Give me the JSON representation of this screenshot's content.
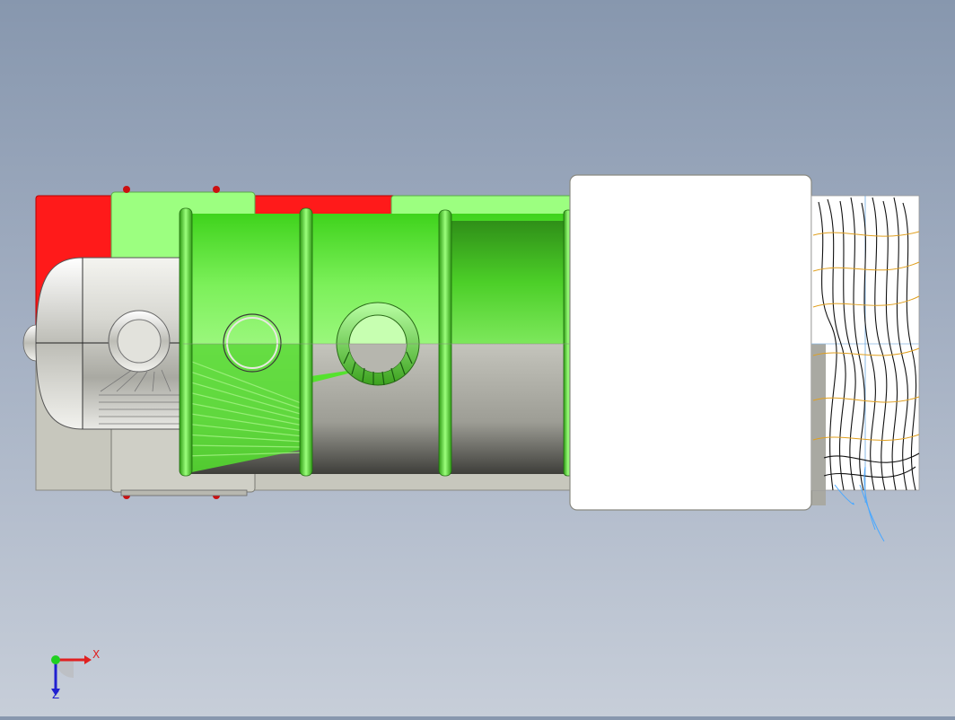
{
  "viewport": {
    "background_top": "#8797ae",
    "background_bottom": "#c7ced9"
  },
  "model": {
    "colors": {
      "frame_red": "#ff1a1a",
      "light_green": "#9cff80",
      "bright_green": "#4ee02a",
      "dark_green": "#1f7a12",
      "motor_silver": "#d9d9d4",
      "housing_gray": "#c3c3b9",
      "box_white": "#ffffff",
      "wire_black": "#111111",
      "wire_orange": "#e0a020",
      "wire_blue": "#4aa8ff"
    }
  },
  "axis_triad": {
    "x_label": "X",
    "z_label": "Z",
    "x_color": "#e02020",
    "y_color": "#20d020",
    "z_color": "#2020d0"
  }
}
